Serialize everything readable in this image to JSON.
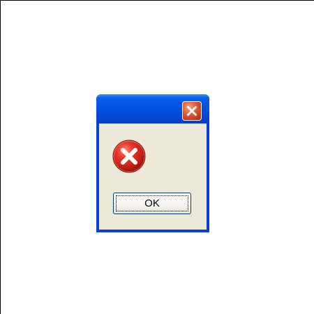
{
  "dialog": {
    "title": "",
    "close_icon": "close-icon",
    "status_icon": "error-icon",
    "message": "",
    "buttons": {
      "ok_label": "OK"
    }
  },
  "colors": {
    "titlebar": "#0054e3",
    "close_button": "#e1663f",
    "client_background": "#ece9d8",
    "error_icon": "#d42a1a"
  }
}
